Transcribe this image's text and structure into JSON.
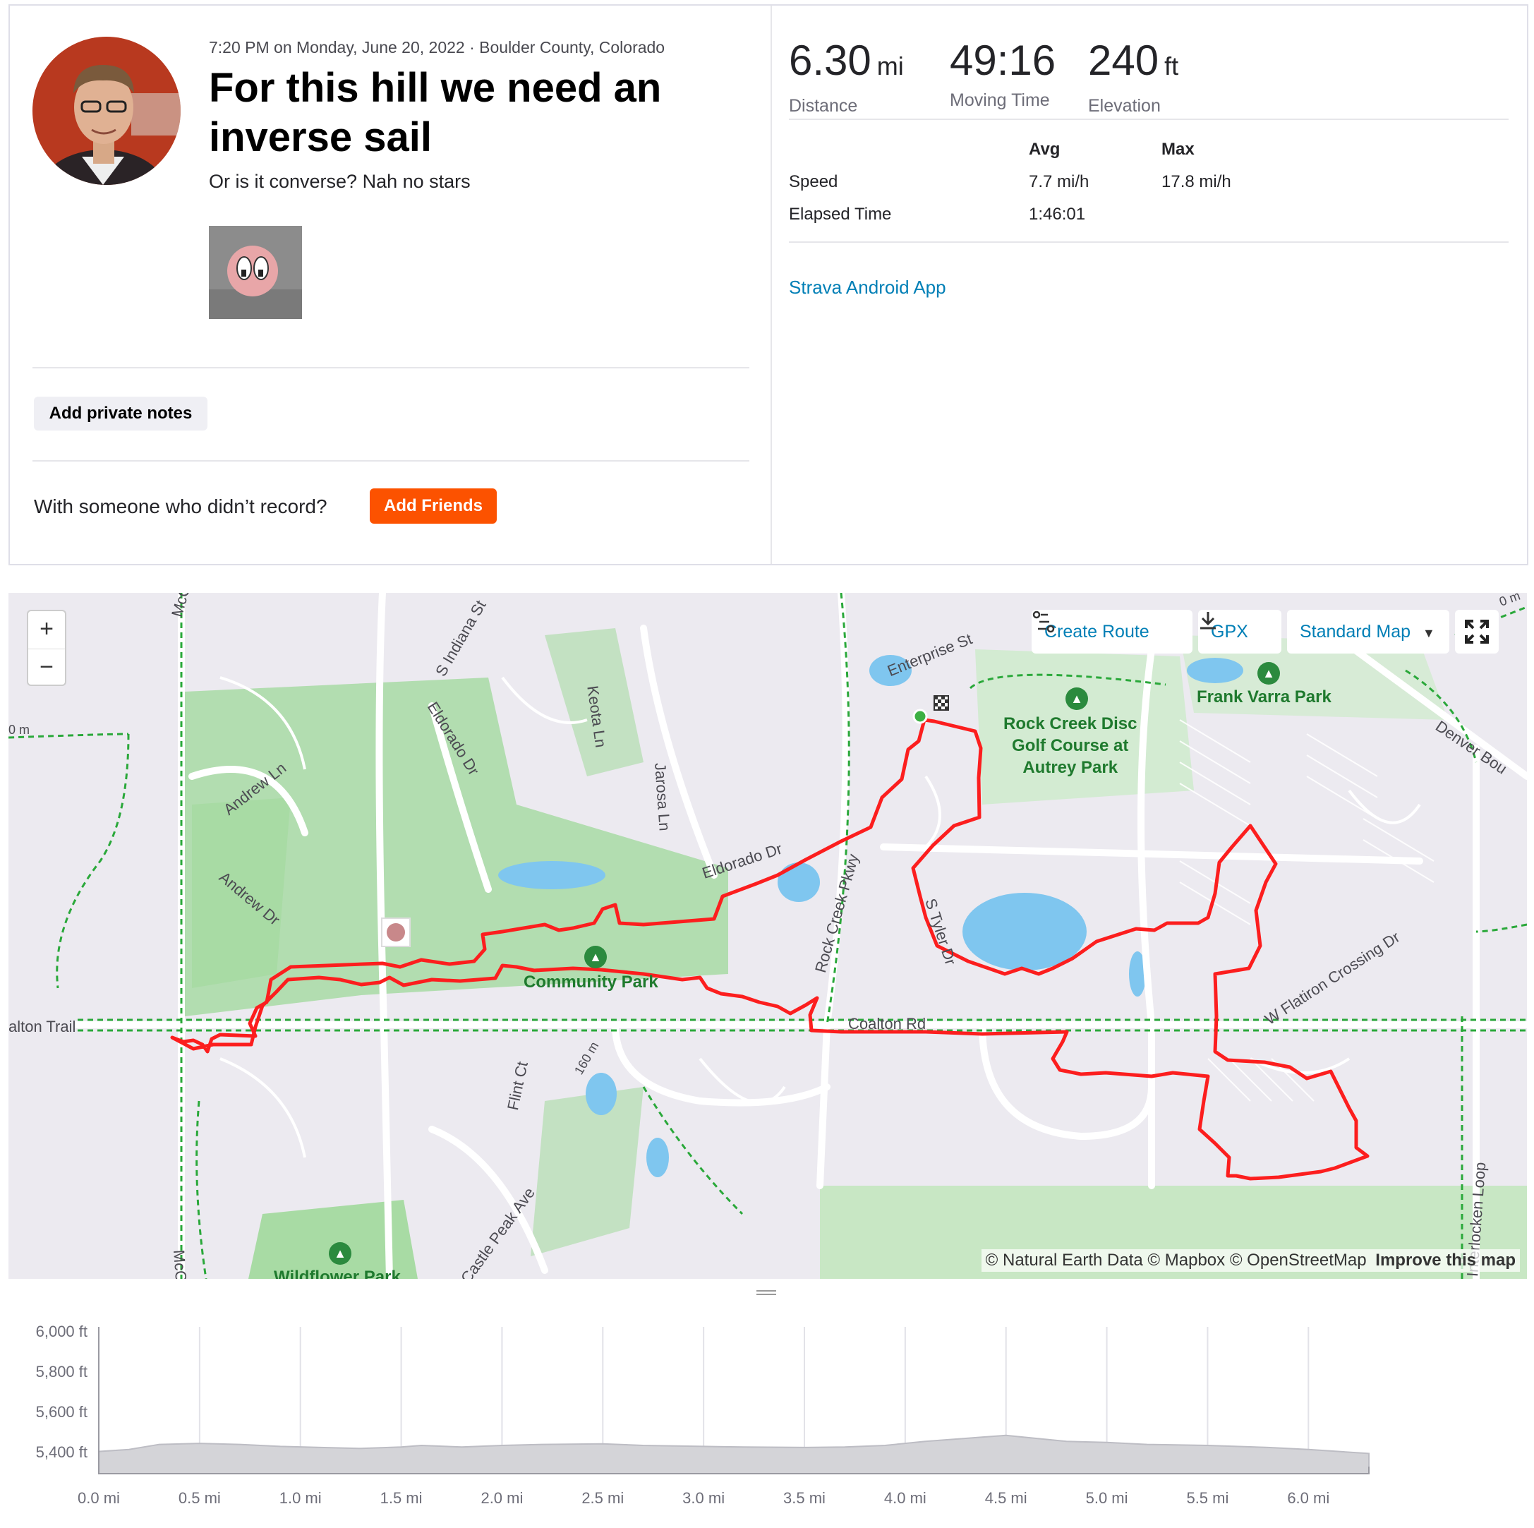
{
  "activity": {
    "meta": "7:20 PM on Monday, June 20, 2022 · Boulder County, Colorado",
    "title": "For this hill we need an inverse sail",
    "description": "Or is it converse? Nah no stars",
    "add_notes_label": "Add private notes",
    "with_someone_text": "With someone who didn’t record?",
    "add_friends_label": "Add Friends"
  },
  "stats": {
    "distance": {
      "value": "6.30",
      "unit": "mi",
      "label": "Distance"
    },
    "moving_time": {
      "value": "49:16",
      "label": "Moving Time"
    },
    "elevation": {
      "value": "240",
      "unit": "ft",
      "label": "Elevation"
    },
    "table_headers": {
      "avg": "Avg",
      "max": "Max"
    },
    "speed": {
      "label": "Speed",
      "avg": "7.7 mi/h",
      "max": "17.8 mi/h"
    },
    "elapsed": {
      "label": "Elapsed Time",
      "avg": "1:46:01"
    },
    "app_link": "Strava Android App"
  },
  "map": {
    "zoom_in": "+",
    "zoom_out": "−",
    "create_route": "Create Route",
    "gpx": "GPX",
    "map_style": "Standard Map",
    "attribution": "© Natural Earth Data © Mapbox © OpenStreetMap",
    "improve": "Improve this map",
    "streets": {
      "mccaslin": "McCaslin Blvd",
      "indiana": "S Indiana St",
      "eldorado1": "Eldorado Dr",
      "keota": "Keota Ln",
      "jarosa": "Jarosa Ln",
      "andrew_ln": "Andrew Ln",
      "andrew_dr": "Andrew Dr",
      "eldorado2": "Eldorado Dr",
      "rock_creek": "Rock Creek Pkwy",
      "enterprise": "Enterprise St",
      "tyler": "S Tyler Dr",
      "coalton_rd": "Coalton Rd",
      "coalton_trail": "alton Trail",
      "flatiron": "W Flatiron Crossing Dr",
      "denver": "Denver Bou",
      "flint": "Flint Ct",
      "castle": "Castle Peak Ave",
      "interlocken": "Interlocken Loop",
      "mc_bottom": "McC",
      "scale_left": "0 m",
      "scale_mid": "160 m",
      "scale_right": "0 m"
    },
    "parks": {
      "rock_creek": "Rock Creek Disc\nGolf Course at\nAutrey Park",
      "frank_varra": "Frank Varra Park",
      "community": "Community Park",
      "wildflower": "Wildflower Park"
    }
  },
  "elevation_chart": {
    "y_labels": [
      "6,000 ft",
      "5,800 ft",
      "5,600 ft",
      "5,400 ft"
    ],
    "x_labels": [
      "0.0 mi",
      "0.5 mi",
      "1.0 mi",
      "1.5 mi",
      "2.0 mi",
      "2.5 mi",
      "3.0 mi",
      "3.5 mi",
      "4.0 mi",
      "4.5 mi",
      "5.0 mi",
      "5.5 mi",
      "6.0 mi"
    ]
  },
  "chart_data": {
    "type": "area",
    "title": "",
    "xlabel": "",
    "ylabel": "",
    "xlim": [
      0,
      6.3
    ],
    "ylim": [
      5300,
      6000
    ],
    "series": [
      {
        "x": [
          0.0,
          0.15,
          0.3,
          0.5,
          0.7,
          0.9,
          1.1,
          1.3,
          1.5,
          1.6,
          1.8,
          2.0,
          2.2,
          2.5,
          2.7,
          3.0,
          3.2,
          3.5,
          3.7,
          3.9,
          4.1,
          4.3,
          4.5,
          4.6,
          4.8,
          5.0,
          5.2,
          5.5,
          5.8,
          6.0,
          6.3
        ],
        "y": [
          5410,
          5420,
          5445,
          5450,
          5445,
          5435,
          5430,
          5425,
          5432,
          5440,
          5432,
          5440,
          5445,
          5448,
          5440,
          5435,
          5432,
          5430,
          5432,
          5440,
          5460,
          5475,
          5490,
          5480,
          5460,
          5455,
          5445,
          5440,
          5430,
          5420,
          5400
        ]
      }
    ]
  }
}
